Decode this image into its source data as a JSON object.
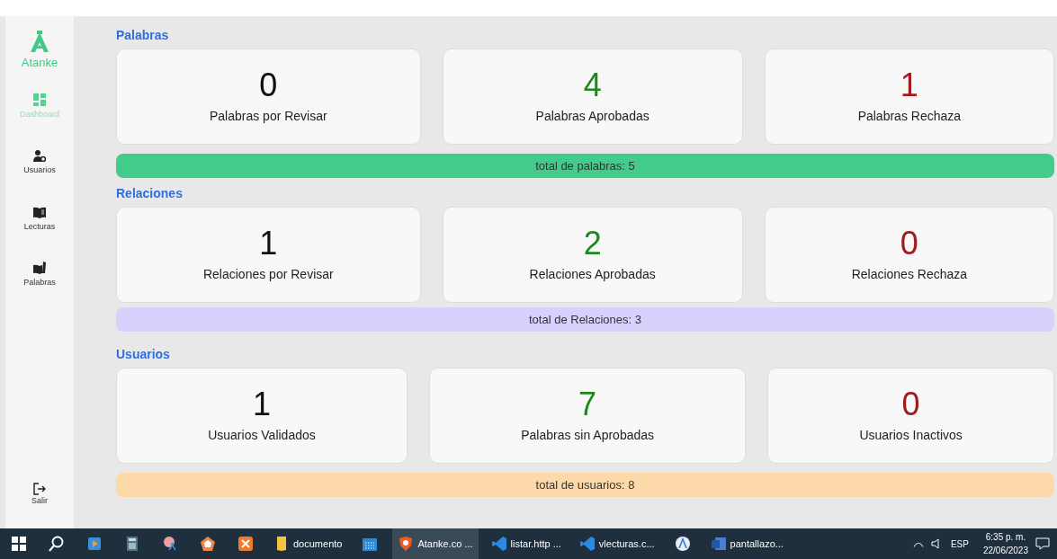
{
  "sidebar": {
    "logo": "Atanke",
    "items": [
      {
        "label": "Dashboard",
        "selected": true
      },
      {
        "label": "Usuarios",
        "selected": false
      },
      {
        "label": "Lecturas",
        "selected": false
      },
      {
        "label": "Palabras",
        "selected": false
      }
    ],
    "logout": "Salir"
  },
  "sections": [
    {
      "title": "Palabras",
      "cards": [
        {
          "value": "0",
          "label": "Palabras por Revisar",
          "color": "#111111"
        },
        {
          "value": "4",
          "label": "Palabras Aprobadas",
          "color": "#1a8a1a"
        },
        {
          "value": "1",
          "label": "Palabras Rechaza",
          "color": "#a11d1d"
        }
      ],
      "total": "total de palabras: 5",
      "color": "#43cb8b"
    },
    {
      "title": "Relaciones",
      "cards": [
        {
          "value": "1",
          "label": "Relaciones por Revisar",
          "color": "#111111"
        },
        {
          "value": "2",
          "label": "Relaciones Aprobadas",
          "color": "#1a8a1a"
        },
        {
          "value": "0",
          "label": "Relaciones Rechaza",
          "color": "#a11d1d"
        }
      ],
      "total": "total de Relaciones: 3",
      "color": "#d8d1fb"
    },
    {
      "title": "Usuarios",
      "cards": [
        {
          "value": "1",
          "label": "Usuarios Validados",
          "color": "#111111"
        },
        {
          "value": "7",
          "label": "Palabras sin Aprobadas",
          "color": "#1a8a1a"
        },
        {
          "value": "0",
          "label": "Usuarios Inactivos",
          "color": "#a11d1d"
        }
      ],
      "total": "total de usuarios: 8",
      "color": "#fdd9a9"
    }
  ],
  "taskbar": {
    "items": [
      {
        "kind": "start",
        "selected": false
      },
      {
        "kind": "search",
        "selected": false
      },
      {
        "kind": "media",
        "selected": false
      },
      {
        "kind": "calculator",
        "selected": false
      },
      {
        "kind": "snip",
        "selected": false
      },
      {
        "kind": "pentagon",
        "selected": false
      },
      {
        "kind": "xampp",
        "selected": false
      },
      {
        "kind": "folder",
        "label": "documento",
        "selected": false
      },
      {
        "kind": "calendar",
        "selected": false
      },
      {
        "kind": "browser",
        "label": "Atanke.co ...",
        "selected": true
      },
      {
        "kind": "vscode",
        "label": "listar.http ...",
        "selected": false
      },
      {
        "kind": "vscode",
        "label": "vlecturas.c...",
        "selected": false
      },
      {
        "kind": "studio",
        "selected": false
      },
      {
        "kind": "word",
        "label": "pantallazo...",
        "selected": false
      }
    ],
    "tray": {
      "language": "ESP",
      "time": "6:35 p. m.",
      "date": "22/06/2023"
    }
  }
}
